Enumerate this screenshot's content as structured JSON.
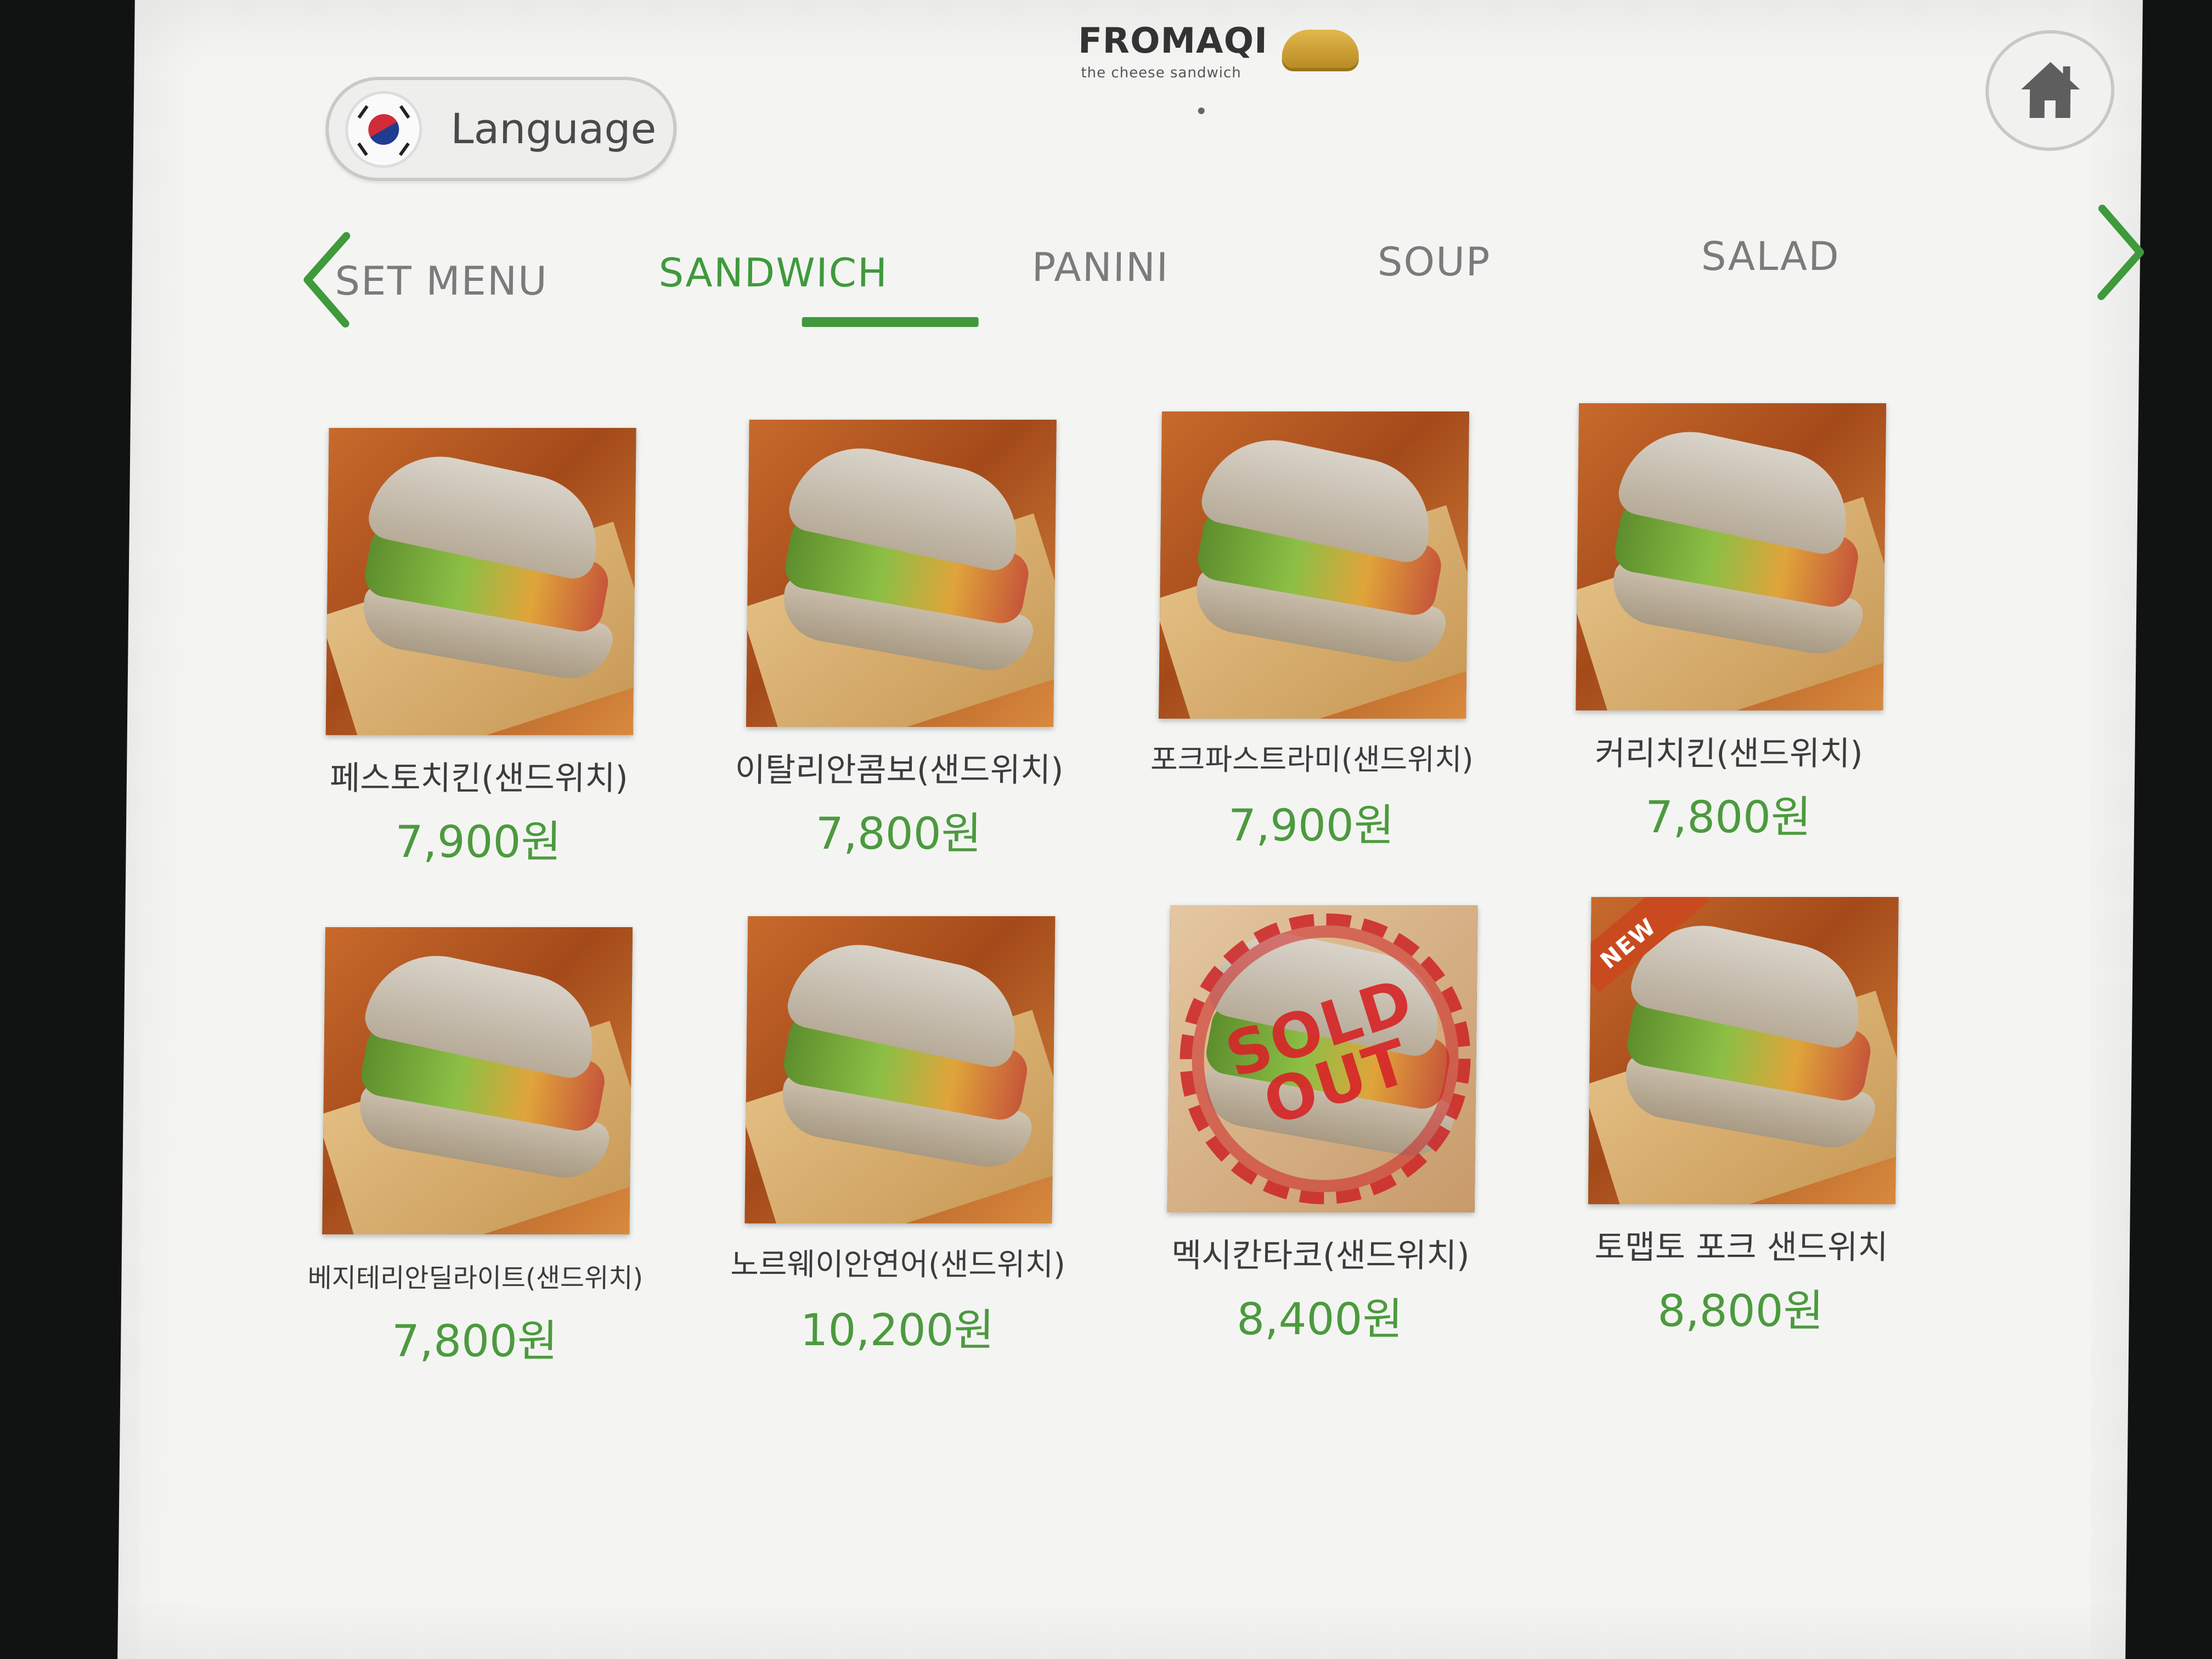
{
  "header": {
    "logo_text": "FROMAQI",
    "logo_tagline": "the cheese sandwich",
    "language_label": "Language",
    "language_flag": "south-korea-flag-icon",
    "home_icon": "home-icon"
  },
  "tabs": [
    {
      "label": "SET MENU",
      "active": false
    },
    {
      "label": "SANDWICH",
      "active": true
    },
    {
      "label": "PANINI",
      "active": false
    },
    {
      "label": "SOUP",
      "active": false
    },
    {
      "label": "SALAD",
      "active": false
    }
  ],
  "nav": {
    "prev_icon": "chevron-left-icon",
    "next_icon": "chevron-right-icon"
  },
  "colors": {
    "accent": "#3f9a3c",
    "sold_out": "#d62628"
  },
  "menu": [
    {
      "name": "페스토치킨(샌드위치)",
      "price": "7,900원",
      "badge": ""
    },
    {
      "name": "이탈리안콤보(샌드위치)",
      "price": "7,800원",
      "badge": ""
    },
    {
      "name": "포크파스트라미(샌드위치)",
      "price": "7,900원",
      "badge": ""
    },
    {
      "name": "커리치킨(샌드위치)",
      "price": "7,800원",
      "badge": ""
    },
    {
      "name": "베지테리안딜라이트(샌드위치)",
      "price": "7,800원",
      "badge": ""
    },
    {
      "name": "노르웨이안연어(샌드위치)",
      "price": "10,200원",
      "badge": ""
    },
    {
      "name": "멕시칸타코(샌드위치)",
      "price": "8,400원",
      "badge": "SOLD OUT"
    },
    {
      "name": "토맵토 포크 샌드위치",
      "price": "8,800원",
      "badge": "NEW"
    }
  ]
}
